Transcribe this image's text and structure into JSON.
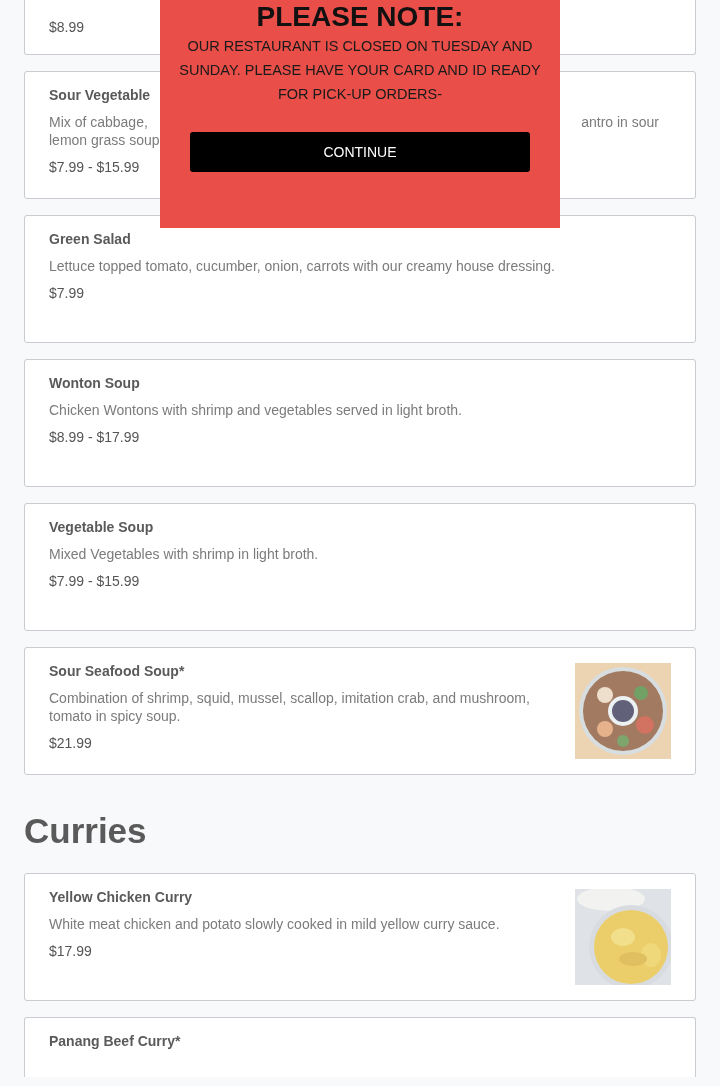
{
  "sections": [
    {
      "items": [
        {
          "kind": "partial_top",
          "price": "$8.99"
        },
        {
          "kind": "covered",
          "name": "Sour Vegetable",
          "description_fragments": [
            "Mix of cabbage,",
            "antro in sour",
            "lemon grass soup"
          ],
          "price": "$7.99 - $15.99"
        },
        {
          "kind": "item",
          "name": "Green Salad",
          "description": "Lettuce topped tomato, cucumber, onion, carrots with our creamy house dressing.",
          "price": "$7.99",
          "picture": false
        },
        {
          "kind": "item",
          "name": "Wonton Soup",
          "description": "Chicken Wontons with shrimp and vegetables served in light broth.",
          "price": "$8.99 - $17.99",
          "picture": false
        },
        {
          "kind": "item",
          "name": "Vegetable Soup",
          "description": "Mixed Vegetables with shrimp in light broth.",
          "price": "$7.99 - $15.99",
          "picture": false
        },
        {
          "kind": "item",
          "name": "Sour Seafood Soup*",
          "description": "Combination of shrimp, squid, mussel, scallop, imitation crab, and mushroom, tomato in spicy soup.",
          "price": "$21.99",
          "picture": true
        }
      ]
    },
    {
      "heading": "Curries",
      "items": [
        {
          "kind": "item",
          "name": "Yellow Chicken Curry",
          "description": "White meat chicken and potato slowly cooked in mild yellow curry sauce.",
          "price": "$17.99",
          "picture": true
        },
        {
          "kind": "partial_bottom",
          "name": "Panang Beef Curry*"
        }
      ]
    }
  ],
  "modal": {
    "title": "PLEASE NOTE:",
    "message": "OUR RESTAURANT IS CLOSED ON TUESDAY AND SUNDAY. PLEASE HAVE YOUR CARD AND ID READY FOR PICK-UP ORDERS-",
    "button": "CONTINUE"
  }
}
